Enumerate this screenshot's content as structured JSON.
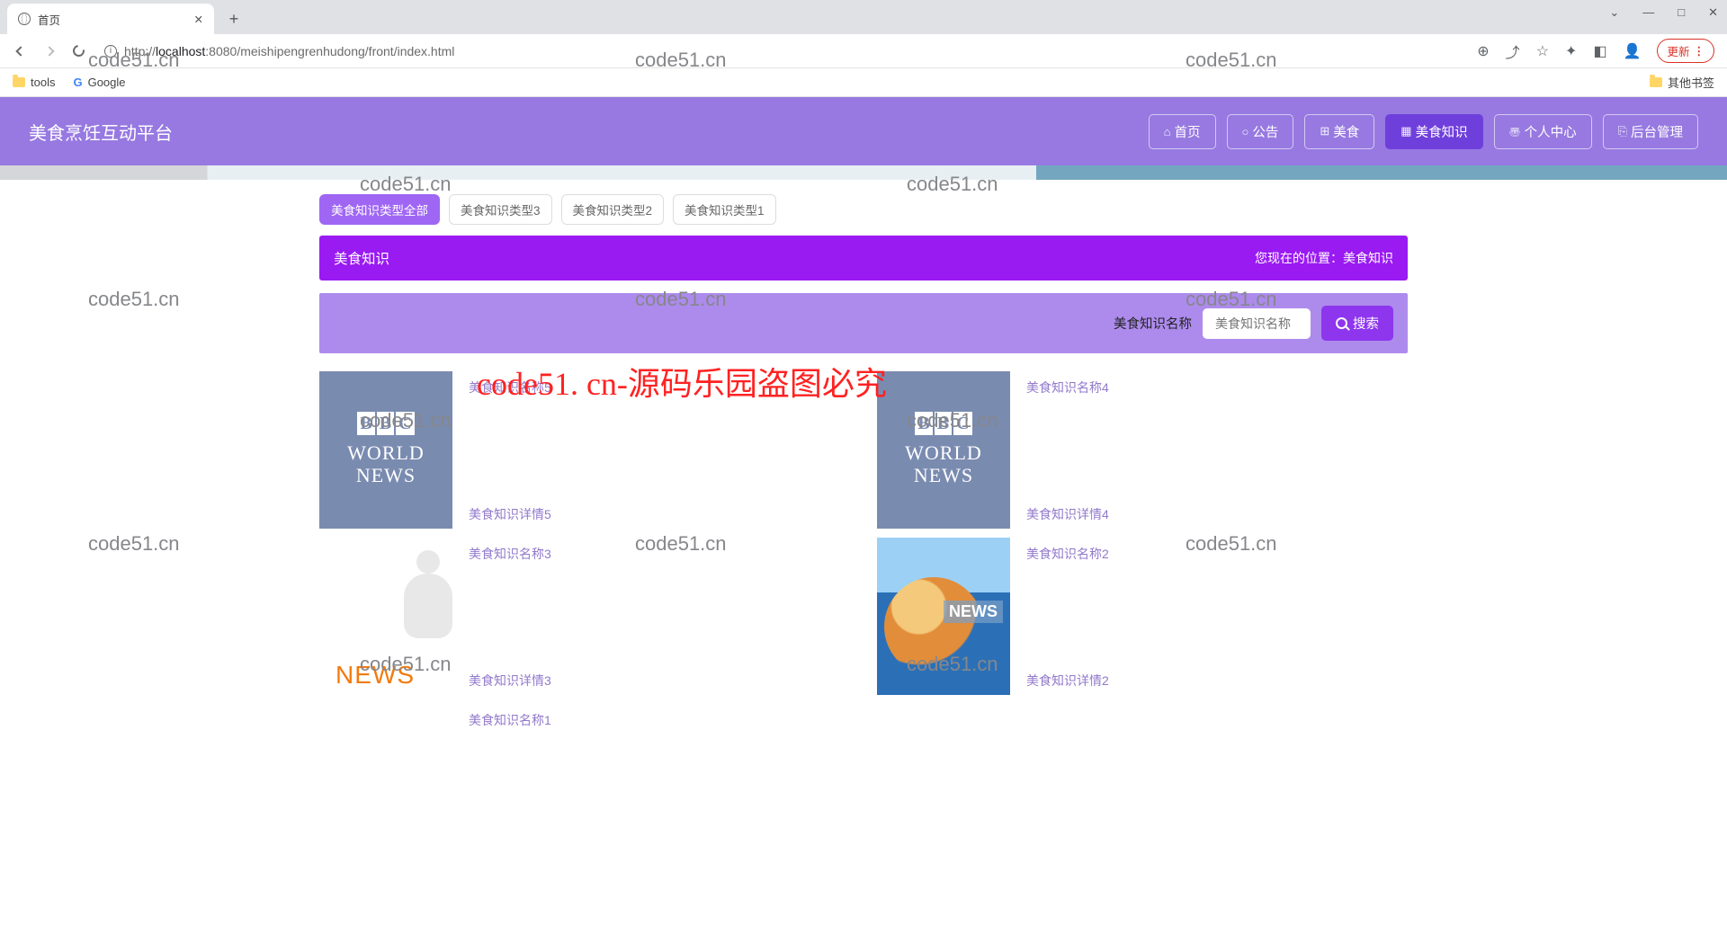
{
  "browser": {
    "tab_title": "首页",
    "url_prefix": "http://",
    "url_host": "localhost",
    "url_port": ":8080",
    "url_path": "/meishipengrenhudong/front/index.html",
    "update_label": "更新",
    "bookmarks": {
      "tools": "tools",
      "google": "Google",
      "other": "其他书签"
    }
  },
  "header": {
    "site_title": "美食烹饪互动平台",
    "nav": [
      {
        "icon": "⌂",
        "label": "首页"
      },
      {
        "icon": "○",
        "label": "公告"
      },
      {
        "icon": "⊞",
        "label": "美食"
      },
      {
        "icon": "▦",
        "label": "美食知识"
      },
      {
        "icon": "〠",
        "label": "个人中心"
      },
      {
        "icon": "⎘",
        "label": "后台管理"
      }
    ]
  },
  "chips": [
    "美食知识类型全部",
    "美食知识类型3",
    "美食知识类型2",
    "美食知识类型1"
  ],
  "panel": {
    "title": "美食知识",
    "breadcrumb_prefix": "您现在的位置：",
    "breadcrumb_current": "美食知识"
  },
  "search": {
    "label": "美食知识名称",
    "placeholder": "美食知识名称",
    "button": "搜索"
  },
  "items": [
    {
      "title": "美食知识名称5",
      "sub": "美食知识详情5",
      "thumb": "bbc"
    },
    {
      "title": "美食知识名称4",
      "sub": "美食知识详情4",
      "thumb": "bbc"
    },
    {
      "title": "美食知识名称3",
      "sub": "美食知识详情3",
      "thumb": "figure"
    },
    {
      "title": "美食知识名称2",
      "sub": "美食知识详情2",
      "thumb": "globe"
    },
    {
      "title": "美食知识名称1",
      "sub": "",
      "thumb": "none"
    }
  ],
  "watermark": {
    "small": "code51.cn",
    "big": "code51. cn-源码乐园盗图必究"
  }
}
